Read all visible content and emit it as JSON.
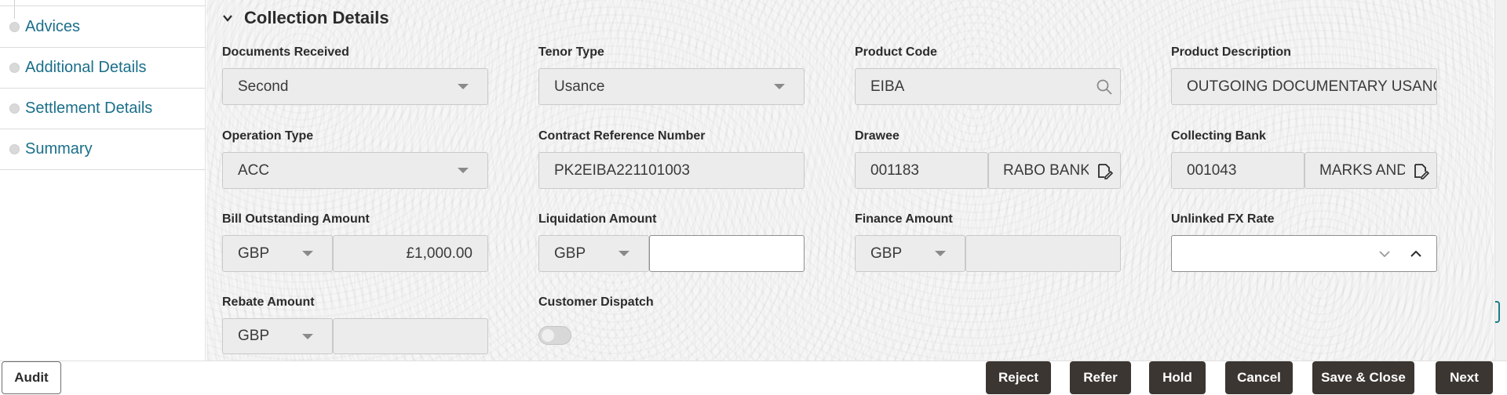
{
  "sidebar": {
    "items": [
      {
        "label": "Advices"
      },
      {
        "label": "Additional Details"
      },
      {
        "label": "Settlement Details"
      },
      {
        "label": "Summary"
      }
    ]
  },
  "section": {
    "title": "Collection Details"
  },
  "fields": {
    "documents_received": {
      "label": "Documents Received",
      "value": "Second"
    },
    "tenor_type": {
      "label": "Tenor Type",
      "value": "Usance"
    },
    "product_code": {
      "label": "Product Code",
      "value": "EIBA"
    },
    "product_description": {
      "label": "Product Description",
      "value": "OUTGOING DOCUMENTARY USANCE"
    },
    "operation_type": {
      "label": "Operation Type",
      "value": "ACC"
    },
    "contract_reference": {
      "label": "Contract Reference Number",
      "value": "PK2EIBA221101003"
    },
    "drawee": {
      "label": "Drawee",
      "code": "001183",
      "name": "RABO BANK"
    },
    "collecting_bank": {
      "label": "Collecting Bank",
      "code": "001043",
      "name": "MARKS AND"
    },
    "bill_outstanding": {
      "label": "Bill Outstanding Amount",
      "currency": "GBP",
      "amount": "£1,000.00"
    },
    "liquidation_amount": {
      "label": "Liquidation Amount",
      "currency": "GBP",
      "amount": ""
    },
    "finance_amount": {
      "label": "Finance Amount",
      "currency": "GBP",
      "amount": ""
    },
    "unlinked_fx_rate": {
      "label": "Unlinked FX Rate",
      "value": ""
    },
    "rebate_amount": {
      "label": "Rebate Amount",
      "currency": "GBP",
      "amount": ""
    },
    "customer_dispatch": {
      "label": "Customer Dispatch",
      "enabled": false
    }
  },
  "footer": {
    "audit": "Audit",
    "reject": "Reject",
    "refer": "Refer",
    "hold": "Hold",
    "cancel": "Cancel",
    "save_close": "Save & Close",
    "next": "Next"
  },
  "colors": {
    "link": "#1a6f8a",
    "dark_button": "#3b3632",
    "accent": "#1a7f86"
  }
}
